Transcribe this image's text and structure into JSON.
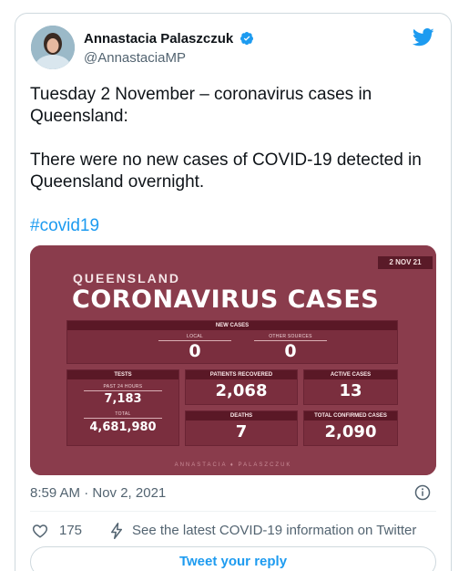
{
  "author": {
    "name": "Annastacia Palaszczuk",
    "handle": "@AnnastaciaMP"
  },
  "tweet": {
    "line1": "Tuesday 2 November – coronavirus cases in Queensland:",
    "line2": "There were no new cases of COVID-19 detected in Queensland overnight.",
    "hashtag": "#covid19"
  },
  "graphic": {
    "date_tag": "2 NOV 21",
    "state": "QUEENSLAND",
    "headline": "CORONAVIRUS CASES",
    "new_cases": {
      "header": "NEW CASES",
      "local_label": "LOCAL",
      "local_value": "0",
      "other_label": "OTHER SOURCES",
      "other_value": "0"
    },
    "tests": {
      "header": "TESTS",
      "past24_label": "PAST 24 HOURS",
      "past24_value": "7,183",
      "total_label": "TOTAL",
      "total_value": "4,681,980"
    },
    "recovered": {
      "header": "PATIENTS RECOVERED",
      "value": "2,068"
    },
    "active": {
      "header": "ACTIVE CASES",
      "value": "13"
    },
    "deaths": {
      "header": "DEATHS",
      "value": "7"
    },
    "confirmed": {
      "header": "TOTAL CONFIRMED CASES",
      "value": "2,090"
    },
    "footer": "ANNASTACIA ♦ PALASZCZUK"
  },
  "meta": {
    "timestamp": "8:59 AM · Nov 2, 2021"
  },
  "actions": {
    "likes": "175",
    "info_link": "See the latest COVID-19 information on Twitter"
  },
  "reply": {
    "label": "Tweet your reply"
  },
  "colors": {
    "brand_blue": "#1d9bf0",
    "graphic_bg": "#8a3c4c",
    "panel_header": "#5a1826"
  },
  "icons": [
    "verified-badge-icon",
    "twitter-bird-icon",
    "info-icon",
    "heart-icon",
    "lightning-bolt-icon"
  ]
}
